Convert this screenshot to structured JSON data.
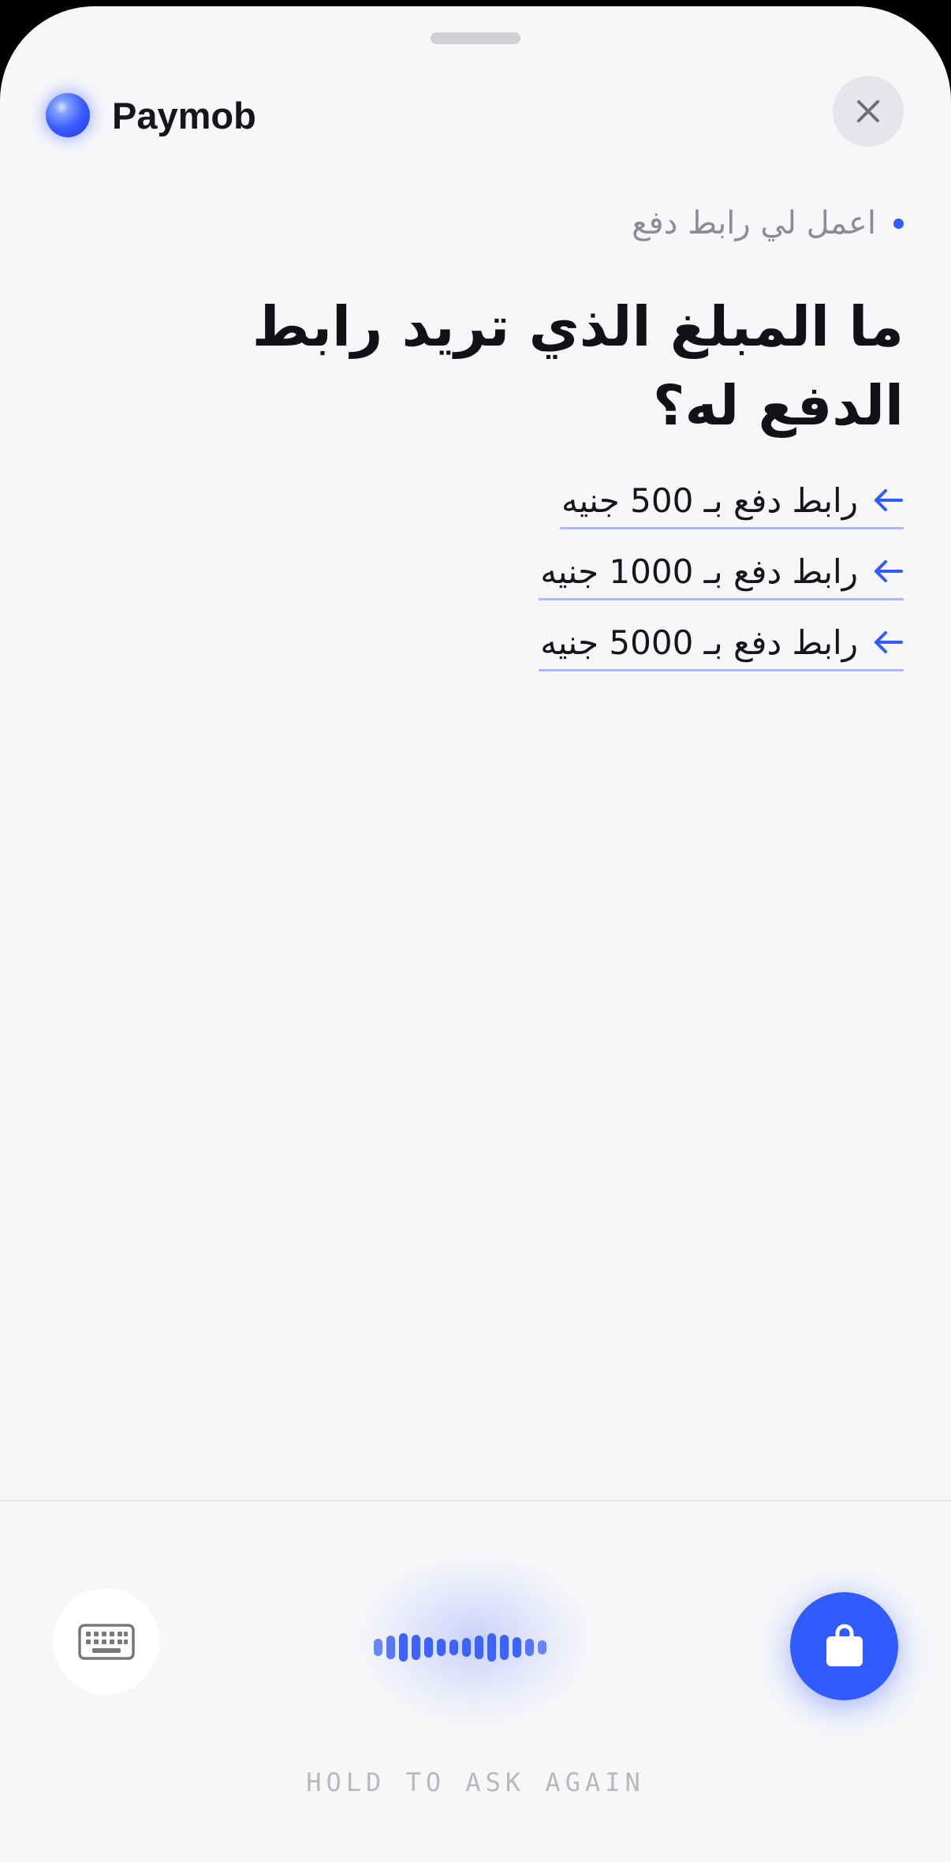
{
  "header": {
    "brand_name": "Paymob",
    "logo_icon": "blue-orb-logo",
    "close_icon": "close-icon"
  },
  "conversation": {
    "user_prompt": "اعمل لي رابط دفع",
    "question": "ما المبلغ الذي تريد رابط الدفع له؟",
    "suggestions": [
      {
        "label": "رابط دفع بـ 500 جنيه"
      },
      {
        "label": "رابط دفع بـ 1000 جنيه"
      },
      {
        "label": "رابط دفع بـ 5000 جنيه"
      }
    ]
  },
  "footer": {
    "keyboard_icon": "keyboard-icon",
    "voice_icon": "voice-waveform",
    "bag_icon": "shopping-bag-icon",
    "hold_label": "HOLD TO ASK AGAIN"
  },
  "colors": {
    "accent": "#2f5bff",
    "background": "#f7f7f9",
    "text_primary": "#111116",
    "text_muted": "#8c8c94"
  }
}
